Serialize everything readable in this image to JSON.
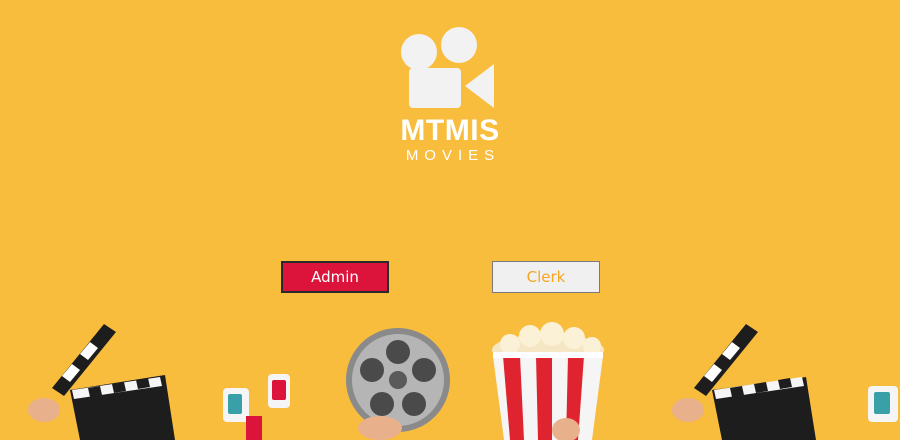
{
  "brand": {
    "logo_icon": "movie-camera-icon",
    "title": "MTMIS",
    "subtitle": "MOVIES"
  },
  "buttons": {
    "admin_label": "Admin",
    "clerk_label": "Clerk"
  },
  "colors": {
    "background": "#f9bd3d",
    "admin_button": "#dc143c",
    "clerk_text": "#f5a623"
  }
}
